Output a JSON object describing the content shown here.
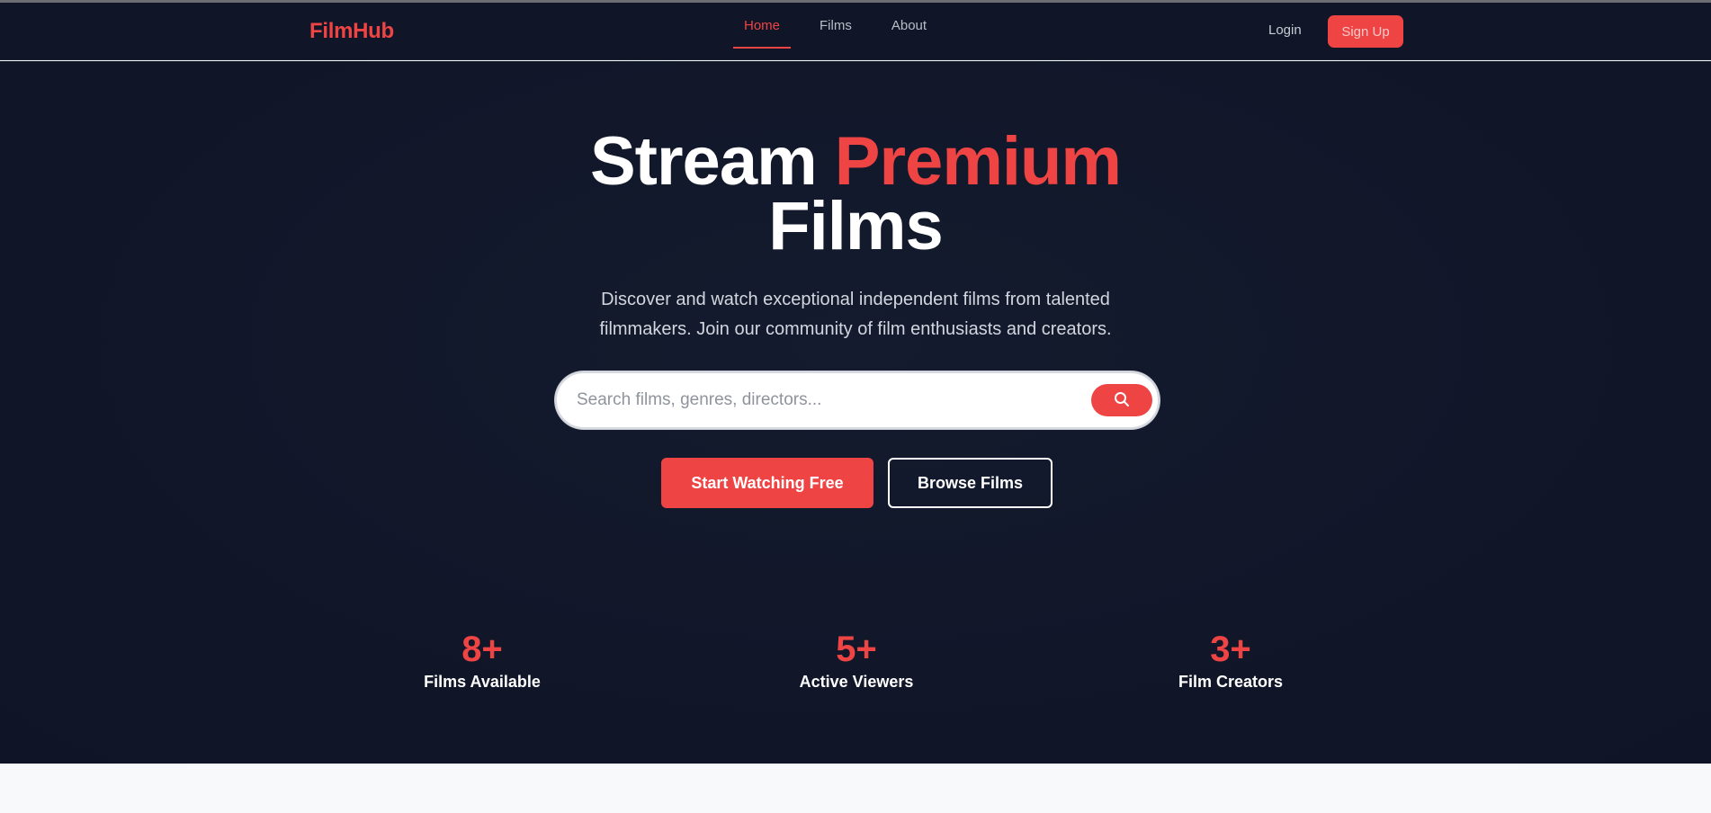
{
  "brand": {
    "name": "FilmHub",
    "accent_color": "#ef4444"
  },
  "nav": {
    "items": [
      {
        "label": "Home",
        "active": true
      },
      {
        "label": "Films",
        "active": false
      },
      {
        "label": "About",
        "active": false
      }
    ],
    "login_label": "Login",
    "signup_label": "Sign Up"
  },
  "hero": {
    "headline_part1": "Stream ",
    "headline_accent": "Premium",
    "headline_part2": "Films",
    "subtitle": "Discover and watch exceptional independent films from talented filmmakers. Join our community of film enthusiasts and creators.",
    "search": {
      "placeholder": "Search films, genres, directors...",
      "value": "",
      "button_icon": "search-icon"
    },
    "primary_cta": "Start Watching Free",
    "secondary_cta": "Browse Films"
  },
  "stats": [
    {
      "value": "8+",
      "label": "Films Available"
    },
    {
      "value": "5+",
      "label": "Active Viewers"
    },
    {
      "value": "3+",
      "label": "Film Creators"
    }
  ]
}
